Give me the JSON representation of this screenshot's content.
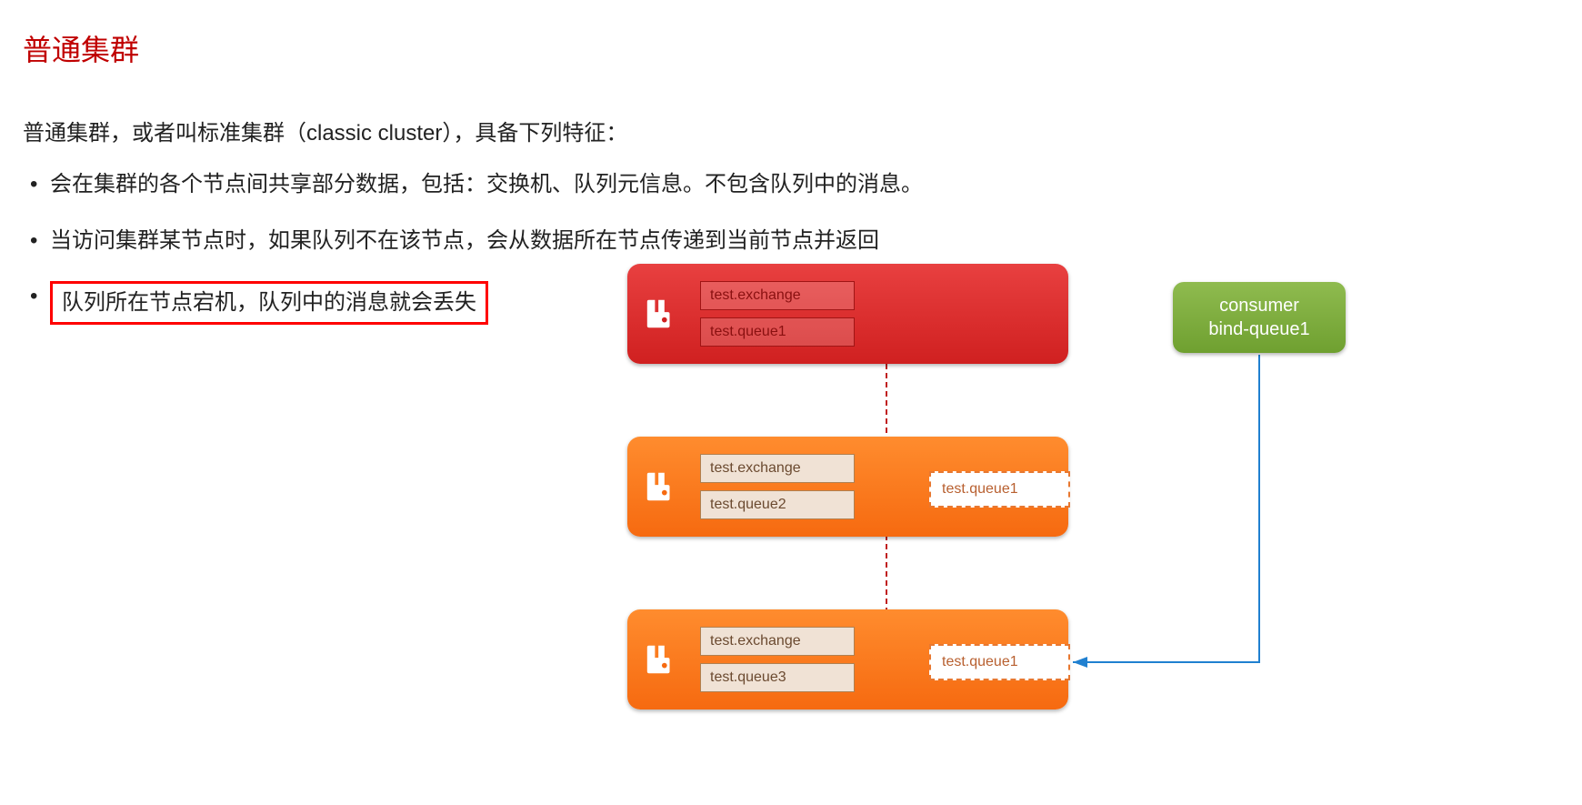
{
  "title": "普通集群",
  "intro": "普通集群，或者叫标准集群（classic cluster），具备下列特征：",
  "bullets": [
    {
      "text": "会在集群的各个节点间共享部分数据，包括：交换机、队列元信息。不包含队列中的消息。",
      "highlight": false
    },
    {
      "text": "当访问集群某节点时，如果队列不在该节点，会从数据所在节点传递到当前节点并返回",
      "highlight": false
    },
    {
      "text": "队列所在节点宕机，队列中的消息就会丢失",
      "highlight": true
    }
  ],
  "diagram": {
    "node1": {
      "box1": "test.exchange",
      "box2": "test.queue1"
    },
    "node2": {
      "box1": "test.exchange",
      "box2": "test.queue2",
      "ghost": "test.queue1"
    },
    "node3": {
      "box1": "test.exchange",
      "box2": "test.queue3",
      "ghost": "test.queue1"
    },
    "consumer": {
      "line1": "consumer",
      "line2": "bind-queue1"
    }
  },
  "colors": {
    "title": "#c00000",
    "highlight_border": "#ff0000",
    "node_red": "#d02020",
    "node_orange": "#f66a10",
    "consumer_green": "#6fa030",
    "dashed_red": "#c02020",
    "solid_blue": "#2080d0"
  }
}
